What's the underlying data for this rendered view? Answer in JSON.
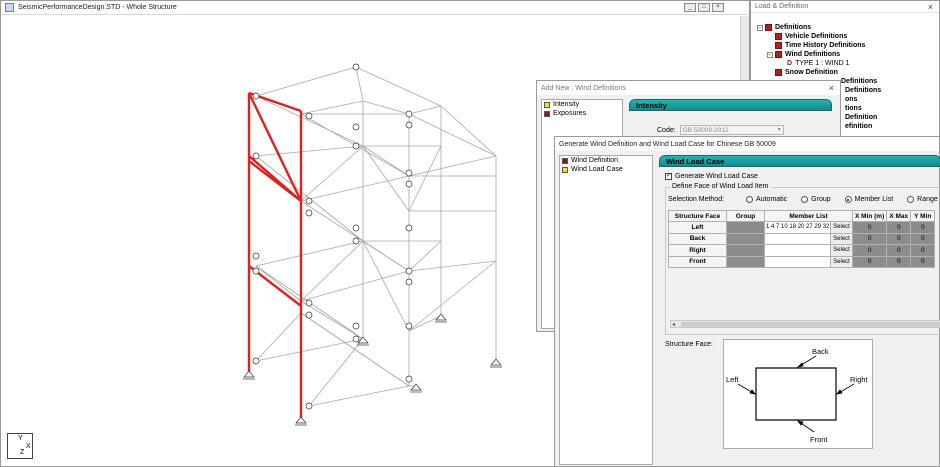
{
  "main_window": {
    "title": "SeismicPerformanceDesign.STD - Whole Structure",
    "buttons": [
      "_",
      "□",
      "×"
    ]
  },
  "axis": {
    "y": "Y",
    "x": "X",
    "z": "Z"
  },
  "load_panel": {
    "title": "Load & Definition",
    "close": "×",
    "tree": [
      {
        "label": "Definitions",
        "level": 0,
        "icon": "definition-icon",
        "toggle": "−"
      },
      {
        "label": "Vehicle Definitions",
        "level": 1,
        "icon": "definition-icon"
      },
      {
        "label": "Time History Definitions",
        "level": 1,
        "icon": "definition-icon"
      },
      {
        "label": "Wind Definitions",
        "level": 1,
        "icon": "definition-icon",
        "toggle": "−"
      },
      {
        "label": "TYPE 1 : WIND 1",
        "level": 2,
        "icon": "type-icon"
      },
      {
        "label": "Snow Definition",
        "level": 1,
        "icon": "definition-icon"
      },
      {
        "label": "Definitions",
        "level": 1,
        "partial": true
      },
      {
        "label": "Definitions",
        "level": 1,
        "partial": true
      },
      {
        "label": "ons",
        "level": 1,
        "partial": true
      },
      {
        "label": "tions",
        "level": 1,
        "partial": true
      },
      {
        "label": "Definition",
        "level": 1,
        "partial": true
      },
      {
        "label": "efinition",
        "level": 1,
        "partial": true
      }
    ]
  },
  "add_new_dialog": {
    "title": "Add New : Wind Definitions",
    "close": "×",
    "list": [
      {
        "label": "Intensity",
        "color": "yellow"
      },
      {
        "label": "Exposures",
        "color": "red"
      }
    ],
    "header": "Intensity",
    "code_label": "Code:",
    "code_value": "GB 50009-2012"
  },
  "generate_dialog": {
    "title": "Generate Wind Definition and Wind Load Case for Chinese GB 50009",
    "list": [
      {
        "label": "Wind Definition",
        "color": "red"
      },
      {
        "label": "Wind Load Case",
        "color": "yellow"
      }
    ],
    "header": "Wind Load Case",
    "generate_checkbox_label": "Generate Wind Load Case",
    "group_legend": "Define Face of Wind Load Item",
    "selection_label": "Selection Method:",
    "radios": [
      {
        "label": "Automatic",
        "selected": false
      },
      {
        "label": "Group",
        "selected": false
      },
      {
        "label": "Member List",
        "selected": true
      },
      {
        "label": "Range",
        "selected": false
      }
    ],
    "table": {
      "headers": [
        "Structure Face",
        "Group",
        "Member List",
        "",
        "X Min (m)",
        "X Max",
        "Y Min"
      ],
      "rows": [
        {
          "face": "Left",
          "members": "1 4 7 10 18 20 27 29 32",
          "select": "Select",
          "xmin": "0",
          "xmax": "0",
          "ymin": "0"
        },
        {
          "face": "Back",
          "members": "",
          "select": "Select",
          "xmin": "0",
          "xmax": "0",
          "ymin": "0"
        },
        {
          "face": "Right",
          "members": "",
          "select": "Select",
          "xmin": "0",
          "xmax": "0",
          "ymin": "0"
        },
        {
          "face": "Front",
          "members": "",
          "select": "Select",
          "xmin": "0",
          "xmax": "0",
          "ymin": "0"
        }
      ]
    },
    "structure_face_label": "Structure Face:",
    "diagram": {
      "back": "Back",
      "left": "Left",
      "right": "Right",
      "front": "Front"
    }
  }
}
